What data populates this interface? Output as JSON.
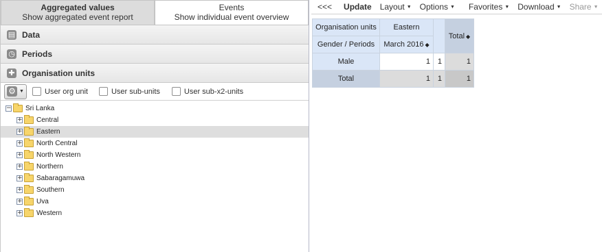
{
  "type_toggle": {
    "aggregated": {
      "title": "Aggregated values",
      "subtitle": "Show aggregated event report"
    },
    "events": {
      "title": "Events",
      "subtitle": "Show individual event overview"
    }
  },
  "accordion": {
    "data": "Data",
    "periods": "Periods",
    "org_units": "Organisation units"
  },
  "org_options": {
    "user_org_unit": "User org unit",
    "user_sub_units": "User sub-units",
    "user_sub_x2_units": "User sub-x2-units"
  },
  "tree": {
    "root": "Sri Lanka",
    "children": [
      "Central",
      "Eastern",
      "North Central",
      "North Western",
      "Northern",
      "Sabaragamuwa",
      "Southern",
      "Uva",
      "Western"
    ],
    "selected": "Eastern",
    "root_toggle": "−",
    "child_toggle": "+"
  },
  "toolbar": {
    "collapse": "<<<",
    "update": "Update",
    "layout": "Layout",
    "options": "Options",
    "favorites": "Favorites",
    "download": "Download",
    "share": "Share"
  },
  "pivot": {
    "row1_dim": "Organisation units",
    "org_value": "Eastern",
    "row2_dim": "Gender / Periods",
    "period": "March 2016",
    "total_header": "Total",
    "rows": [
      {
        "label": "Male",
        "values": [
          "1",
          "1"
        ],
        "total": "1"
      },
      {
        "label": "Total",
        "values": [
          "1",
          "1"
        ],
        "total": "1"
      }
    ]
  }
}
